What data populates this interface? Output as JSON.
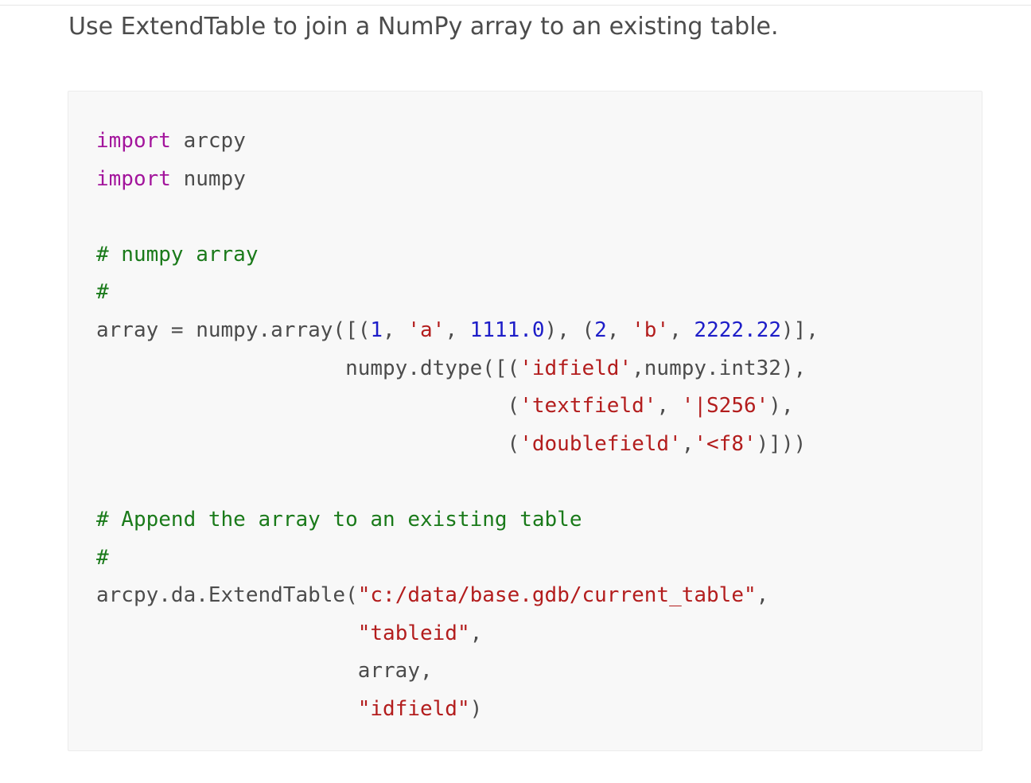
{
  "intro_text": "Use ExtendTable to join a NumPy array to an existing table.",
  "colors": {
    "keyword": "#a3159c",
    "comment": "#1a7a1a",
    "number": "#1d1dc8",
    "string": "#b31d1d",
    "plain": "#4c4c4c",
    "code_background": "#f8f8f8"
  },
  "code_lines": [
    [
      {
        "t": "kw",
        "v": "import"
      },
      {
        "t": "txt",
        "v": " arcpy"
      }
    ],
    [
      {
        "t": "kw",
        "v": "import"
      },
      {
        "t": "txt",
        "v": " numpy"
      }
    ],
    [],
    [
      {
        "t": "cm",
        "v": "# numpy array"
      }
    ],
    [
      {
        "t": "cm",
        "v": "#"
      }
    ],
    [
      {
        "t": "txt",
        "v": "array = numpy.array([("
      },
      {
        "t": "num",
        "v": "1"
      },
      {
        "t": "txt",
        "v": ", "
      },
      {
        "t": "str",
        "v": "'a'"
      },
      {
        "t": "txt",
        "v": ", "
      },
      {
        "t": "num",
        "v": "1111.0"
      },
      {
        "t": "txt",
        "v": "), ("
      },
      {
        "t": "num",
        "v": "2"
      },
      {
        "t": "txt",
        "v": ", "
      },
      {
        "t": "str",
        "v": "'b'"
      },
      {
        "t": "txt",
        "v": ", "
      },
      {
        "t": "num",
        "v": "2222.22"
      },
      {
        "t": "txt",
        "v": ")],"
      }
    ],
    [
      {
        "t": "txt",
        "v": "                    numpy.dtype([("
      },
      {
        "t": "str",
        "v": "'idfield'"
      },
      {
        "t": "txt",
        "v": ",numpy.int32),"
      }
    ],
    [
      {
        "t": "txt",
        "v": "                                 ("
      },
      {
        "t": "str",
        "v": "'textfield'"
      },
      {
        "t": "txt",
        "v": ", "
      },
      {
        "t": "str",
        "v": "'|S256'"
      },
      {
        "t": "txt",
        "v": "),"
      }
    ],
    [
      {
        "t": "txt",
        "v": "                                 ("
      },
      {
        "t": "str",
        "v": "'doublefield'"
      },
      {
        "t": "txt",
        "v": ","
      },
      {
        "t": "str",
        "v": "'<f8'"
      },
      {
        "t": "txt",
        "v": ")]))"
      }
    ],
    [],
    [
      {
        "t": "cm",
        "v": "# Append the array to an existing table"
      }
    ],
    [
      {
        "t": "cm",
        "v": "#"
      }
    ],
    [
      {
        "t": "txt",
        "v": "arcpy.da.ExtendTable("
      },
      {
        "t": "str",
        "v": "\"c:/data/base.gdb/current_table\""
      },
      {
        "t": "txt",
        "v": ","
      }
    ],
    [
      {
        "t": "txt",
        "v": "                     "
      },
      {
        "t": "str",
        "v": "\"tableid\""
      },
      {
        "t": "txt",
        "v": ","
      }
    ],
    [
      {
        "t": "txt",
        "v": "                     array,"
      }
    ],
    [
      {
        "t": "txt",
        "v": "                     "
      },
      {
        "t": "str",
        "v": "\"idfield\""
      },
      {
        "t": "txt",
        "v": ")"
      }
    ]
  ]
}
